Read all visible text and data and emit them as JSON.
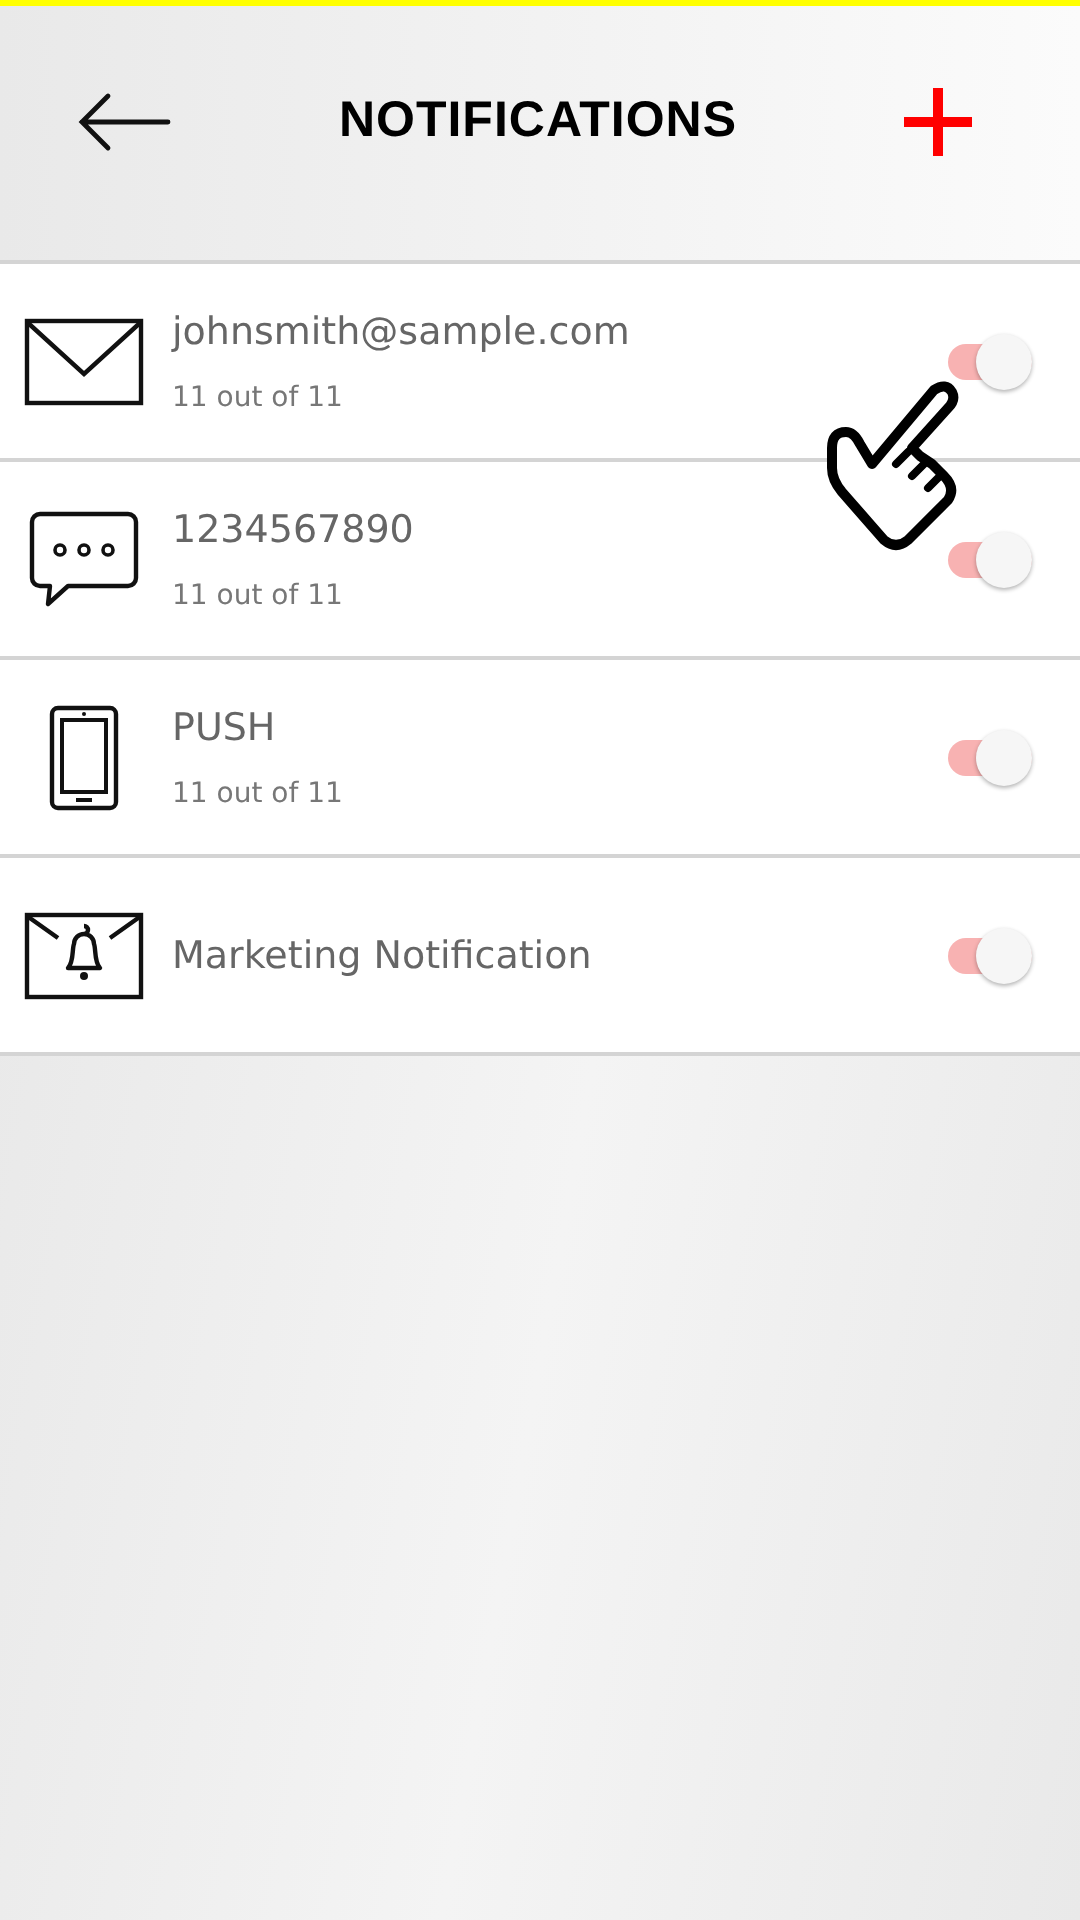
{
  "header": {
    "title": "NOTIFICATIONS"
  },
  "channels": [
    {
      "kind": "email",
      "label": "johnsmith@sample.com",
      "count": "11 out of 11",
      "on": true
    },
    {
      "kind": "sms",
      "label": "1234567890",
      "count": "11 out of 11",
      "on": true
    },
    {
      "kind": "device",
      "label": "PUSH",
      "count": "11 out of 11",
      "on": true
    },
    {
      "kind": "marketing",
      "label": "Marketing Notification",
      "on": true
    }
  ]
}
